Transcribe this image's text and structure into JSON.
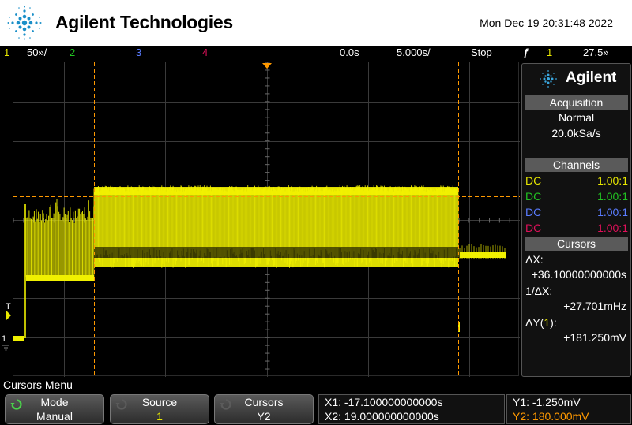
{
  "header": {
    "brand": "Agilent Technologies",
    "datetime": "Mon Dec 19 20:31:48 2022",
    "logo_icon": "agilent-spark-icon"
  },
  "status": {
    "ch1_num": "1",
    "ch1_scale": "50»/",
    "ch2_num": "2",
    "ch3_num": "3",
    "ch4_num": "4",
    "time_delay": "0.0s",
    "time_scale": "5.000s/",
    "run_state": "Stop",
    "trigger_icon": "trigger-edge-icon",
    "trigger_source": "1",
    "trigger_level": "27.5»",
    "colors": {
      "ch1": "#e8e800",
      "ch2": "#22c222",
      "ch3": "#5a7cff",
      "ch4": "#e0105a",
      "cursor": "#ff9900"
    }
  },
  "screen": {
    "trigger_label": "T",
    "ch1_marker": "1",
    "ground_icon": "ground-icon",
    "trigger_position_icon": "trigger-position-icon"
  },
  "panel": {
    "brand": "Agilent",
    "acquisition_title": "Acquisition",
    "acq_mode": "Normal",
    "acq_rate": "20.0kSa/s",
    "channels_title": "Channels",
    "channels": [
      {
        "coupling": "DC",
        "probe": "1.00:1"
      },
      {
        "coupling": "DC",
        "probe": "1.00:1"
      },
      {
        "coupling": "DC",
        "probe": "1.00:1"
      },
      {
        "coupling": "DC",
        "probe": "1.00:1"
      }
    ],
    "cursors_title": "Cursors",
    "dx_label": "ΔX:",
    "dx_value": "+36.10000000000s",
    "inv_dx_label": "1/ΔX:",
    "inv_dx_value": "+27.701mHz",
    "dy_label_pre": "ΔY(",
    "dy_label_ch": "1",
    "dy_label_post": "):",
    "dy_value": "+181.250mV"
  },
  "menu": {
    "title": "Cursors Menu",
    "softkeys": [
      {
        "top": "Mode",
        "bottom": "Manual",
        "icon": "rotate-arrow-icon"
      },
      {
        "top": "Source",
        "bottom": "1",
        "icon": "rotate-arrow-icon"
      },
      {
        "top": "Cursors",
        "bottom": "Y2",
        "icon": "rotate-arrow-icon"
      }
    ],
    "readout": {
      "x1": "X1: -17.100000000000s",
      "x2": "X2: 19.000000000000s",
      "y1": "Y1: -1.250mV",
      "y2": "Y2: 180.000mV"
    }
  }
}
